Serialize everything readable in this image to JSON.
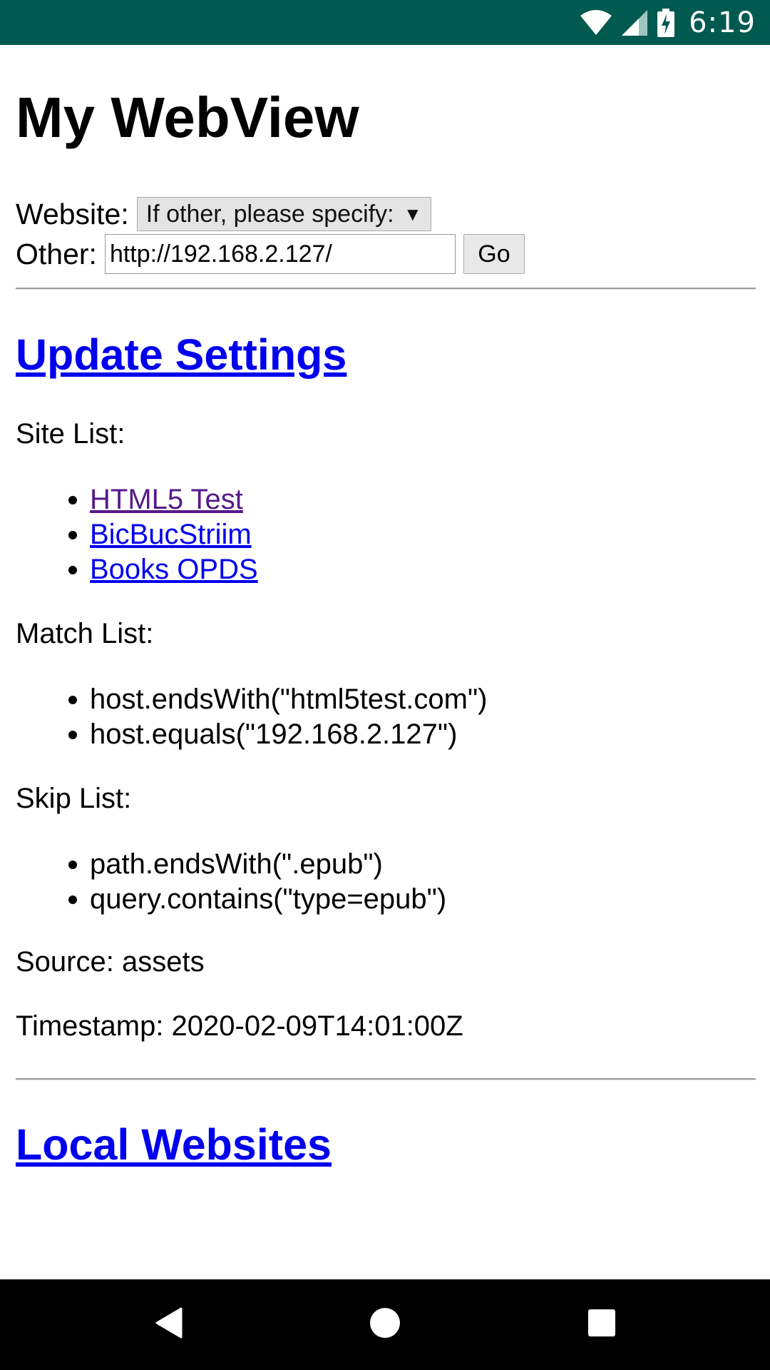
{
  "status_bar": {
    "time": "6:19",
    "icons": [
      "wifi-icon",
      "cell-signal-icon",
      "battery-charging-icon"
    ],
    "background": "#005a4f"
  },
  "page": {
    "title": "My WebView"
  },
  "form": {
    "website_label": "Website:",
    "website_selected": "If other, please specify:",
    "other_label": "Other:",
    "other_value": "http://192.168.2.127/",
    "go_label": "Go"
  },
  "sections": {
    "update_settings": "Update Settings",
    "local_websites": "Local Websites"
  },
  "site_list": {
    "label": "Site List:",
    "items": [
      "HTML5 Test",
      "BicBucStriim",
      "Books OPDS"
    ]
  },
  "match_list": {
    "label": "Match List:",
    "items": [
      "host.endsWith(\"html5test.com\")",
      "host.equals(\"192.168.2.127\")"
    ]
  },
  "skip_list": {
    "label": "Skip List:",
    "items": [
      "path.endsWith(\".epub\")",
      "query.contains(\"type=epub\")"
    ]
  },
  "source": "Source: assets",
  "timestamp": "Timestamp: 2020-02-09T14:01:00Z",
  "colors": {
    "link": "#0000ee",
    "visited_link": "#551a8b",
    "nav_bar": "#000000"
  },
  "nav_bar": {
    "icons": [
      "back-icon",
      "home-icon",
      "recents-icon"
    ]
  }
}
